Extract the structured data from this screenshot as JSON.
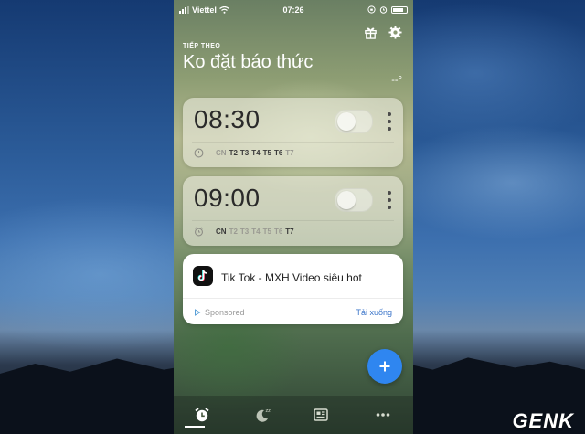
{
  "status_bar": {
    "carrier": "Viettel",
    "time": "07:26"
  },
  "header": {
    "next_label": "TIẾP THEO",
    "title": "Ko đặt báo thức",
    "temperature": "--°"
  },
  "alarms": [
    {
      "time": "08:30",
      "enabled": false,
      "days": [
        {
          "label": "CN",
          "active": false
        },
        {
          "label": "T2",
          "active": true
        },
        {
          "label": "T3",
          "active": true
        },
        {
          "label": "T4",
          "active": true
        },
        {
          "label": "T5",
          "active": true
        },
        {
          "label": "T6",
          "active": true
        },
        {
          "label": "T7",
          "active": false
        }
      ]
    },
    {
      "time": "09:00",
      "enabled": false,
      "days": [
        {
          "label": "CN",
          "active": true
        },
        {
          "label": "T2",
          "active": false
        },
        {
          "label": "T3",
          "active": false
        },
        {
          "label": "T4",
          "active": false
        },
        {
          "label": "T5",
          "active": false
        },
        {
          "label": "T6",
          "active": false
        },
        {
          "label": "T7",
          "active": true
        }
      ]
    }
  ],
  "ad": {
    "title": "Tik Tok - MXH Video siêu hot",
    "sponsored": "Sponsored",
    "cta": "Tải xuống"
  },
  "fab": {
    "label": "+"
  },
  "tabs": [
    {
      "icon": "alarm-icon",
      "active": true
    },
    {
      "icon": "sleep-icon",
      "active": false
    },
    {
      "icon": "news-icon",
      "active": false
    },
    {
      "icon": "more-icon",
      "active": false
    }
  ],
  "watermark": "GENK",
  "colors": {
    "accent": "#2f86f0",
    "day_active": "#3a3a3a",
    "day_inactive": "#9a9a92",
    "cta": "#3a74c9"
  }
}
